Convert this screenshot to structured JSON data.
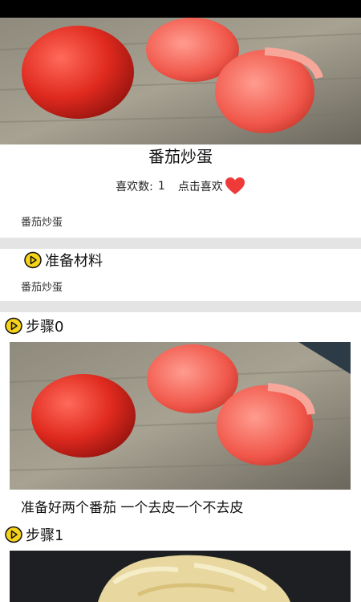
{
  "recipe": {
    "title": "番茄炒蛋",
    "likes_label": "喜欢数:",
    "likes_count": "1",
    "like_action": "点击喜欢",
    "description": "番茄炒蛋"
  },
  "ingredients": {
    "heading": "准备材料",
    "text": "番茄炒蛋"
  },
  "steps": [
    {
      "label": "步骤0",
      "text": "准备好两个番茄 一个去皮一个不去皮"
    },
    {
      "label": "步骤1",
      "text": ""
    }
  ],
  "colors": {
    "heart": "#ef3a3a",
    "icon_fill": "#f6d21a",
    "divider": "#e4e4e4"
  }
}
